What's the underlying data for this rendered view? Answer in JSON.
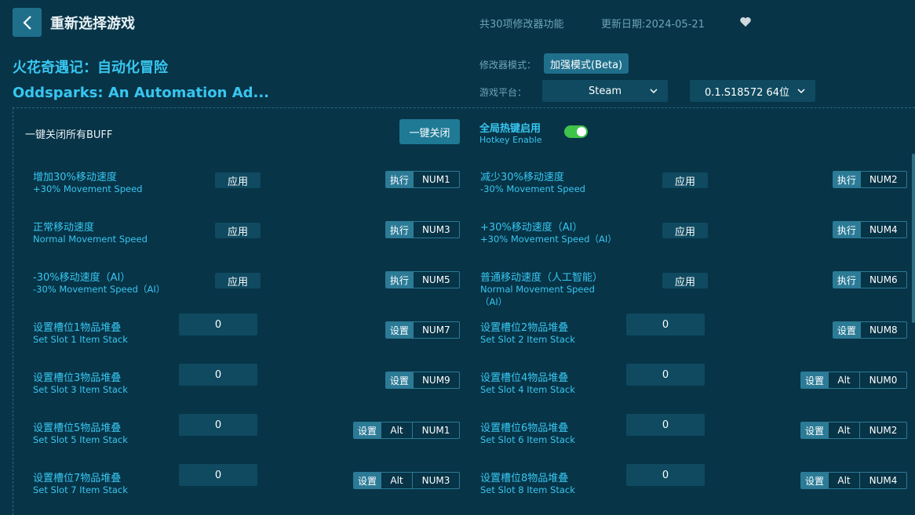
{
  "header": {
    "title": "重新选择游戏",
    "features": "共30项修改器功能",
    "update": "更新日期:2024-05-21"
  },
  "game": {
    "name_cn": "火花奇遇记：自动化冒险",
    "name_en": "Oddsparks: An Automation Ad..."
  },
  "settings": {
    "mode_label": "修改器模式：",
    "mode_value": "加强模式(Beta)",
    "platform_label": "游戏平台：",
    "platform_value": "Steam",
    "version_value": "0.1.S18572 64位"
  },
  "panel": {
    "close_all_label": "一键关闭所有BUFF",
    "close_all_button": "一键关闭",
    "hotkey_cn": "全局热键启用",
    "hotkey_en": "Hotkey Enable",
    "hotkey_enabled": true
  },
  "items": [
    {
      "cn": "增加30%移动速度",
      "en": "+30% Movement Speed",
      "action": "应用",
      "key_label": "执行",
      "keys": [
        "NUM1"
      ]
    },
    {
      "cn": "减少30%移动速度",
      "en": "-30% Movement Speed",
      "action": "应用",
      "key_label": "执行",
      "keys": [
        "NUM2"
      ]
    },
    {
      "cn": "正常移动速度",
      "en": "Normal Movement Speed",
      "action": "应用",
      "key_label": "执行",
      "keys": [
        "NUM3"
      ]
    },
    {
      "cn": "+30%移动速度（AI）",
      "en": "+30% Movement Speed（AI）",
      "action": "应用",
      "key_label": "执行",
      "keys": [
        "NUM4"
      ]
    },
    {
      "cn": "-30%移动速度（AI）",
      "en": "-30% Movement Speed（AI）",
      "action": "应用",
      "key_label": "执行",
      "keys": [
        "NUM5"
      ]
    },
    {
      "cn": "普通移动速度（人工智能）",
      "en": "Normal Movement Speed（AI）",
      "action": "应用",
      "key_label": "执行",
      "keys": [
        "NUM6"
      ]
    },
    {
      "cn": "设置槽位1物品堆叠",
      "en": "Set Slot 1 Item Stack",
      "value": "0",
      "key_label": "设置",
      "keys": [
        "NUM7"
      ]
    },
    {
      "cn": "设置槽位2物品堆叠",
      "en": "Set Slot 2 Item Stack",
      "value": "0",
      "key_label": "设置",
      "keys": [
        "NUM8"
      ]
    },
    {
      "cn": "设置槽位3物品堆叠",
      "en": "Set Slot 3 Item Stack",
      "value": "0",
      "key_label": "设置",
      "keys": [
        "NUM9"
      ]
    },
    {
      "cn": "设置槽位4物品堆叠",
      "en": "Set Slot 4 Item Stack",
      "value": "0",
      "key_label": "设置",
      "keys": [
        "Alt",
        "NUM0"
      ]
    },
    {
      "cn": "设置槽位5物品堆叠",
      "en": "Set Slot 5 Item Stack",
      "value": "0",
      "key_label": "设置",
      "keys": [
        "Alt",
        "NUM1"
      ]
    },
    {
      "cn": "设置槽位6物品堆叠",
      "en": "Set Slot 6 Item Stack",
      "value": "0",
      "key_label": "设置",
      "keys": [
        "Alt",
        "NUM2"
      ]
    },
    {
      "cn": "设置槽位7物品堆叠",
      "en": "Set Slot 7 Item Stack",
      "value": "0",
      "key_label": "设置",
      "keys": [
        "Alt",
        "NUM3"
      ]
    },
    {
      "cn": "设置槽位8物品堆叠",
      "en": "Set Slot 8 Item Stack",
      "value": "0",
      "key_label": "设置",
      "keys": [
        "Alt",
        "NUM4"
      ]
    }
  ],
  "colors": {
    "background": "#073447",
    "accent": "#38c6f0",
    "button": "#1f7a96",
    "toggle_on": "#3ec44a"
  }
}
